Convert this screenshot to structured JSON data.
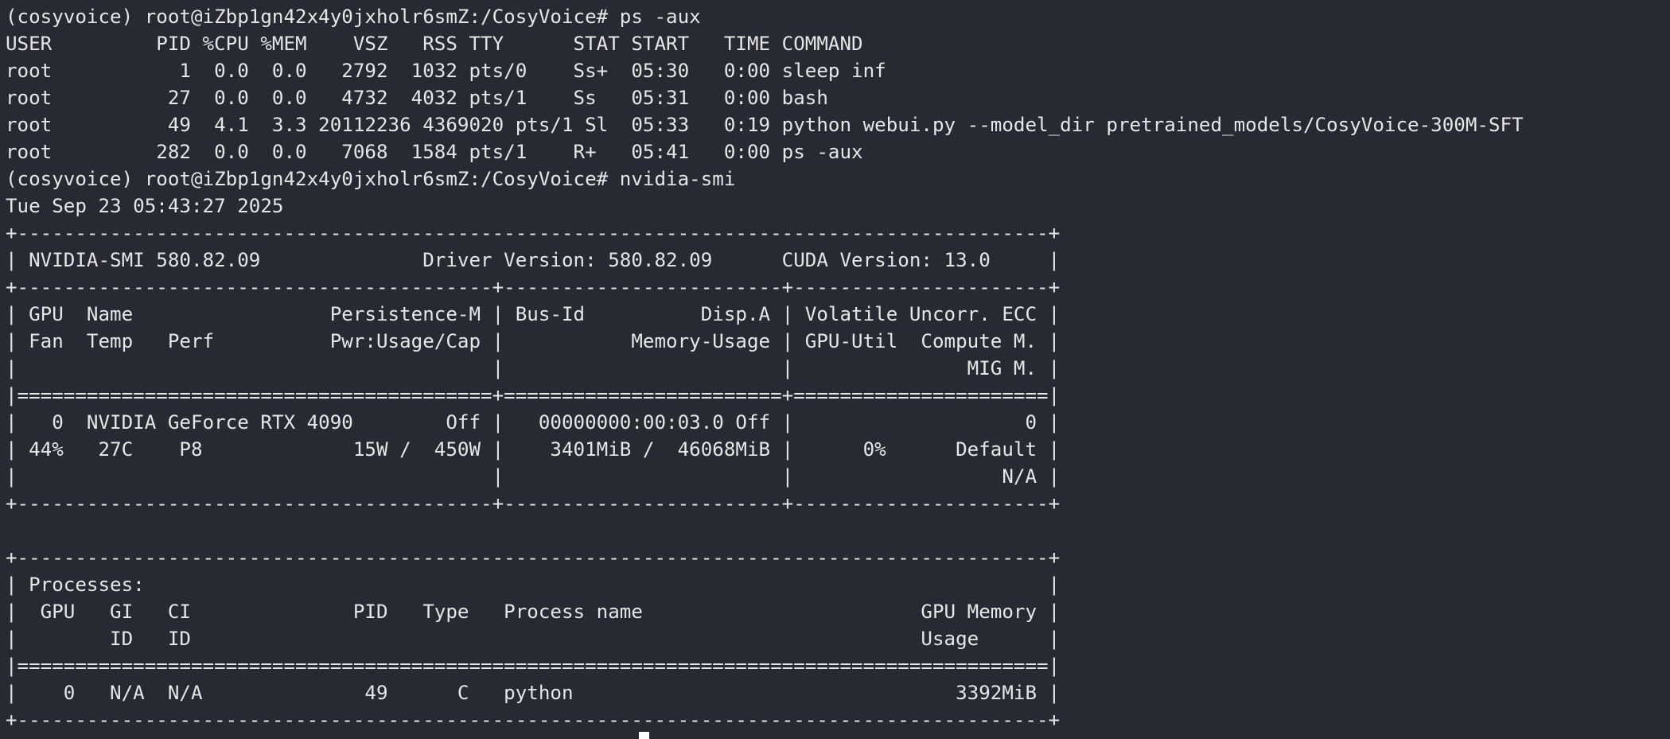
{
  "terminal": {
    "lines": [
      "(cosyvoice) root@iZbp1gn42x4y0jxholr6smZ:/CosyVoice# ps -aux",
      "USER         PID %CPU %MEM    VSZ   RSS TTY      STAT START   TIME COMMAND",
      "root           1  0.0  0.0   2792  1032 pts/0    Ss+  05:30   0:00 sleep inf",
      "root          27  0.0  0.0   4732  4032 pts/1    Ss   05:31   0:00 bash",
      "root          49  4.1  3.3 20112236 4369020 pts/1 Sl  05:33   0:19 python webui.py --model_dir pretrained_models/CosyVoice-300M-SFT",
      "root         282  0.0  0.0   7068  1584 pts/1    R+   05:41   0:00 ps -aux",
      "(cosyvoice) root@iZbp1gn42x4y0jxholr6smZ:/CosyVoice# nvidia-smi",
      "Tue Sep 23 05:43:27 2025",
      "+-----------------------------------------------------------------------------------------+",
      "| NVIDIA-SMI 580.82.09              Driver Version: 580.82.09      CUDA Version: 13.0     |",
      "+-----------------------------------------+------------------------+----------------------+",
      "| GPU  Name                 Persistence-M | Bus-Id          Disp.A | Volatile Uncorr. ECC |",
      "| Fan  Temp   Perf          Pwr:Usage/Cap |           Memory-Usage | GPU-Util  Compute M. |",
      "|                                         |                        |               MIG M. |",
      "|=========================================+========================+======================|",
      "|   0  NVIDIA GeForce RTX 4090        Off |   00000000:00:03.0 Off |                    0 |",
      "| 44%   27C    P8             15W /  450W |    3401MiB /  46068MiB |      0%      Default |",
      "|                                         |                        |                  N/A |",
      "+-----------------------------------------+------------------------+----------------------+",
      "",
      "+-----------------------------------------------------------------------------------------+",
      "| Processes:                                                                              |",
      "|  GPU   GI   CI              PID   Type   Process name                        GPU Memory |",
      "|        ID   ID                                                               Usage      |",
      "|=========================================================================================|",
      "|    0   N/A  N/A              49      C   python                                 3392MiB |",
      "+-----------------------------------------------------------------------------------------+"
    ]
  }
}
